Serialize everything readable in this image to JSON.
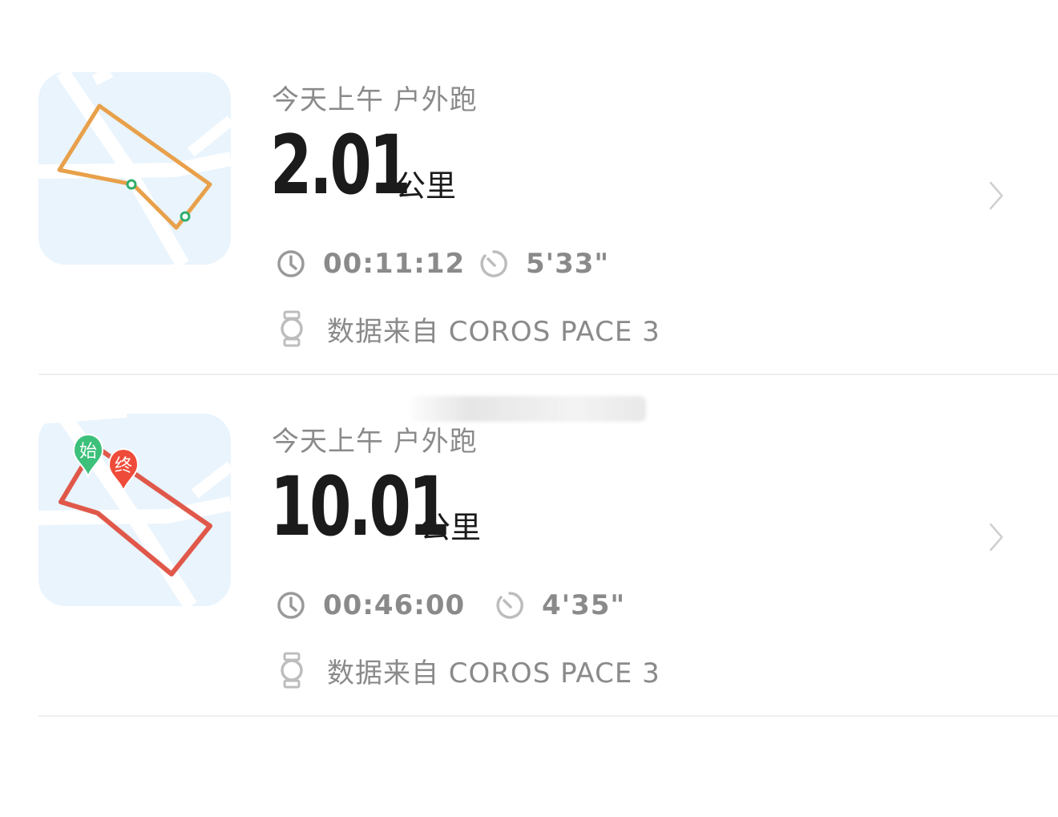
{
  "runs": [
    {
      "title": "今天上午 户外跑",
      "distance": "2.01",
      "unit": "公里",
      "duration": "00:11:12",
      "pace": "5'33\"",
      "source": "数据来自 COROS  PACE 3",
      "route_color": "#e8a04a",
      "route_icons": [
        "start-dot-icon",
        "end-dot-icon"
      ]
    },
    {
      "title": "今天上午 户外跑",
      "distance": "10.01",
      "unit": "公里",
      "duration": "00:46:00",
      "pace": "4'35\"",
      "source": "数据来自 COROS  PACE 3",
      "route_color": "#e0584a",
      "markers": {
        "start_label": "始",
        "end_label": "终",
        "start_color": "#3cc07a",
        "end_color": "#ef4b3a"
      }
    }
  ],
  "icons": {
    "duration": "clock-icon",
    "pace": "stopwatch-icon",
    "source": "watch-icon",
    "detail": "chevron-right-icon"
  },
  "colors": {
    "map_background": "#e9f4fd",
    "road": "#ffffff",
    "primary_text": "#1b1b1b",
    "secondary_text": "#8a8a8a",
    "divider": "#efefef"
  }
}
